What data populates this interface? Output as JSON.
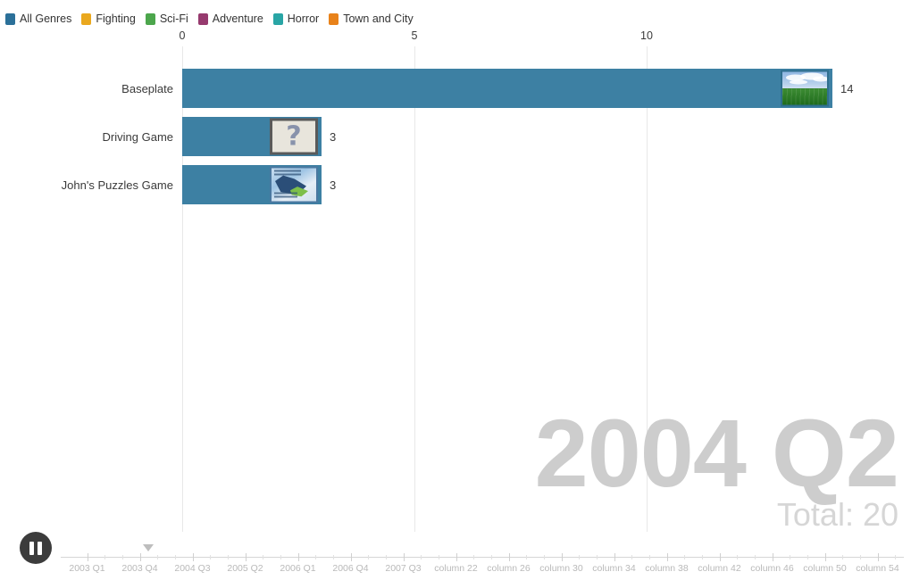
{
  "legend": {
    "items": [
      {
        "label": "All Genres",
        "color": "#2b7099"
      },
      {
        "label": "Fighting",
        "color": "#eaa81e"
      },
      {
        "label": "Sci-Fi",
        "color": "#4ca64c"
      },
      {
        "label": "Adventure",
        "color": "#963a6e"
      },
      {
        "label": "Horror",
        "color": "#29a5a5"
      },
      {
        "label": "Town and City",
        "color": "#e8821a"
      }
    ]
  },
  "caption": {
    "date": "2004 Q2",
    "total": "Total: 20"
  },
  "controls": {
    "play_state": "pause",
    "playhead_label": "2004 Q2"
  },
  "timeline": {
    "labels": [
      "2003 Q1",
      "2003 Q4",
      "2004 Q3",
      "2005 Q2",
      "2006 Q1",
      "2006 Q4",
      "2007 Q3",
      "column 22",
      "column 26",
      "column 30",
      "column 34",
      "column 38",
      "column 42",
      "column 46",
      "column 50",
      "column 54"
    ],
    "playhead_position": 0.104
  },
  "chart_data": {
    "type": "bar",
    "title": "2004 Q2",
    "orientation": "horizontal",
    "categories": [
      "Baseplate",
      "Driving Game",
      "John's Puzzles Game"
    ],
    "values": [
      14,
      3,
      3
    ],
    "value_labels": [
      "14",
      "3",
      "3"
    ],
    "series": [
      {
        "name": "All Genres",
        "values": [
          14,
          3,
          3
        ]
      }
    ],
    "bar_color": "#3d80a3",
    "xlabel": "",
    "ylabel": "",
    "xlim": [
      0,
      15.5
    ],
    "xticks": [
      0,
      5,
      10
    ],
    "xtick_labels": [
      "0",
      "5",
      "10"
    ],
    "grid": true,
    "grid_axis": "x",
    "legend_position": "top-left",
    "total": 20,
    "thumbnails": [
      "field-sky-thumbnail",
      "unknown-placeholder-thumbnail",
      "blue-scene-thumbnail"
    ]
  }
}
